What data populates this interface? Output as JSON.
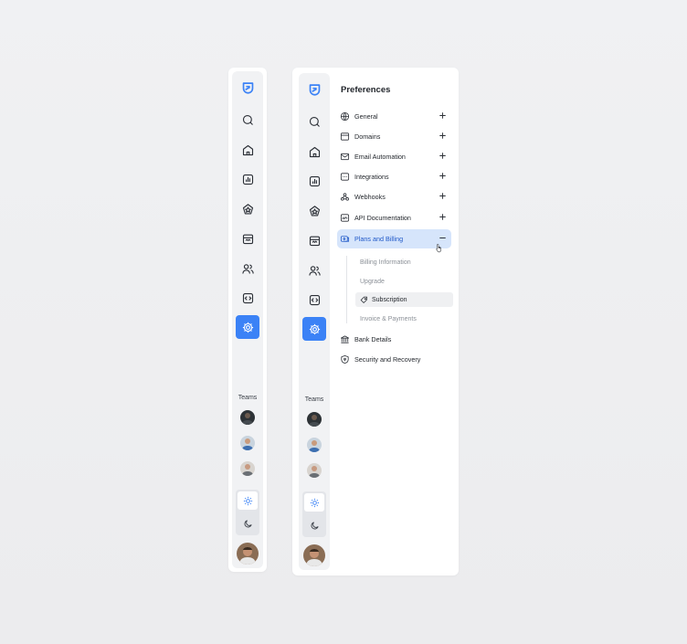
{
  "accent_color": "#3b82f6",
  "rail_icons": [
    "logo-icon",
    "search-icon",
    "home-icon",
    "chart-icon",
    "star-badge-icon",
    "calendar-icon",
    "users-icon",
    "code-icon",
    "gear-icon"
  ],
  "teams_label": "Teams",
  "preferences": {
    "title": "Preferences",
    "items": [
      {
        "label": "General",
        "icon": "globe-icon",
        "control": "plus"
      },
      {
        "label": "Domains",
        "icon": "browser-icon",
        "control": "plus"
      },
      {
        "label": "Email Automation",
        "icon": "mail-icon",
        "control": "plus"
      },
      {
        "label": "Integrations",
        "icon": "integration-icon",
        "control": "plus"
      },
      {
        "label": "Webhooks",
        "icon": "webhook-icon",
        "control": "plus"
      },
      {
        "label": "API Documentation",
        "icon": "api-icon",
        "control": "plus"
      },
      {
        "label": "Plans and Billing",
        "icon": "billing-icon",
        "control": "minus",
        "expanded": true
      }
    ],
    "sub_items": [
      {
        "label": "Billing Information",
        "active": false
      },
      {
        "label": "Upgrade",
        "active": false
      },
      {
        "label": "Subscription",
        "active": true,
        "icon": "tag-icon"
      },
      {
        "label": "Invoice & Payments",
        "active": false
      }
    ],
    "bottom_items": [
      {
        "label": "Bank Details",
        "icon": "bank-icon"
      },
      {
        "label": "Security and Recovery",
        "icon": "shield-icon"
      }
    ]
  }
}
